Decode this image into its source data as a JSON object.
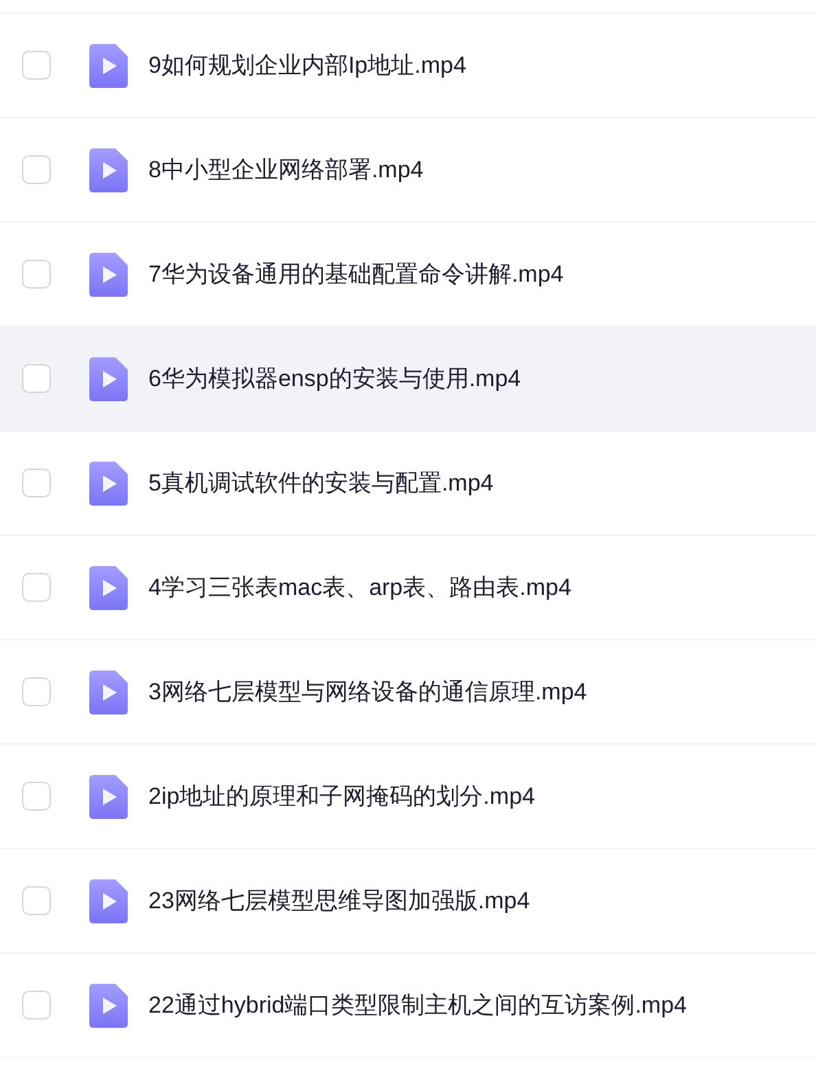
{
  "files": [
    {
      "name": "9如何规划企业内部Ip地址.mp4",
      "checked": false,
      "selected": false
    },
    {
      "name": "8中小型企业网络部署.mp4",
      "checked": false,
      "selected": false
    },
    {
      "name": "7华为设备通用的基础配置命令讲解.mp4",
      "checked": false,
      "selected": false
    },
    {
      "name": "6华为模拟器ensp的安装与使用.mp4",
      "checked": false,
      "selected": true
    },
    {
      "name": "5真机调试软件的安装与配置.mp4",
      "checked": false,
      "selected": false
    },
    {
      "name": "4学习三张表mac表、arp表、路由表.mp4",
      "checked": false,
      "selected": false
    },
    {
      "name": "3网络七层模型与网络设备的通信原理.mp4",
      "checked": false,
      "selected": false
    },
    {
      "name": "2ip地址的原理和子网掩码的划分.mp4",
      "checked": false,
      "selected": false
    },
    {
      "name": "23网络七层模型思维导图加强版.mp4",
      "checked": false,
      "selected": false
    },
    {
      "name": "22通过hybrid端口类型限制主机之间的互访案例.mp4",
      "checked": false,
      "selected": false
    }
  ]
}
